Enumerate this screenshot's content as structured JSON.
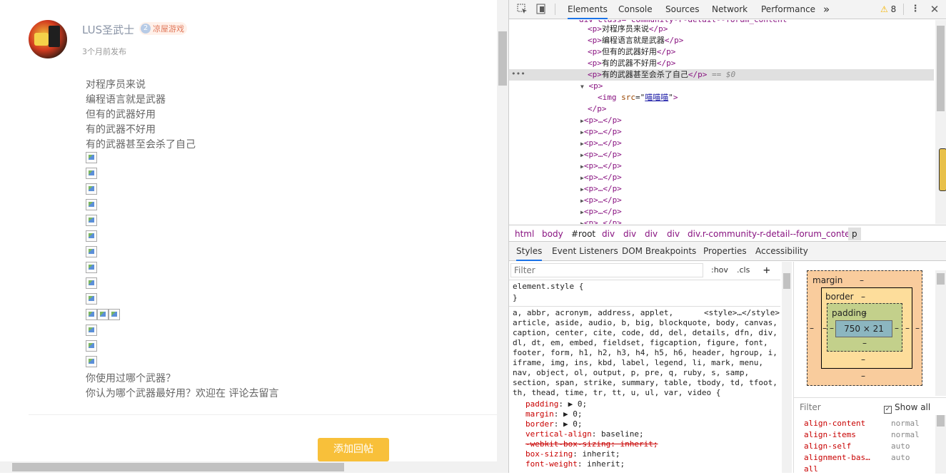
{
  "post": {
    "username": "LUS圣武士",
    "level_badge": "2",
    "level_name": "凉屋游戏",
    "post_time": "3个月前发布",
    "content_lines": [
      "对程序员来说",
      "编程语言就是武器",
      "但有的武器好用",
      "有的武器不好用",
      "有的武器甚至会杀了自己"
    ],
    "outro_lines": [
      "你使用过哪个武器？",
      "你认为哪个武器最好用？欢迎在 评论去留言"
    ],
    "reply_button": "添加回帖"
  },
  "devtools": {
    "tabs": [
      "Elements",
      "Console",
      "Sources",
      "Network",
      "Performance"
    ],
    "more": "»",
    "warnings": "8",
    "dom": {
      "header_cut": "div class=\"community-r-detail--forum_content\"",
      "p_lines": [
        "对程序员来说",
        "编程语言就是武器",
        "但有的武器好用",
        "有的武器不好用",
        "有的武器甚至会杀了自己"
      ],
      "selected_suffix": "== $0",
      "img_tag": "img",
      "img_attr": "src",
      "img_src": "喵喵喵",
      "collapsed": "<p>…</p>"
    },
    "breadcrumbs": [
      "html",
      "body",
      "#root",
      "div",
      "div",
      "div",
      "div",
      "div.r-community-r-detail--forum_content",
      "p"
    ],
    "sub_tabs": [
      "Styles",
      "Event Listeners",
      "DOM Breakpoints",
      "Properties",
      "Accessibility"
    ],
    "styles": {
      "filter_placeholder": "Filter",
      "hov": ":hov",
      "cls": ".cls",
      "plus": "+",
      "element_style": "element.style {",
      "close_brace": "}",
      "ua_source": "<style>…</style>",
      "selector_lines": [
        "a, abbr, acronym, address, applet,",
        "article, aside, audio, b, big, blockquote, body, canvas,",
        "caption, center, cite, code, dd, del, details, dfn, div,",
        "dl, dt, em, embed, fieldset, figcaption, figure, font,",
        "footer, form, h1, h2, h3, h4, h5, h6, header, hgroup, i,",
        "iframe, img, ins, kbd, label, legend, li, mark, menu,",
        "nav, object, ol, output, p, pre, q, ruby, s, samp,",
        "section, span, strike, summary, table, tbody, td, tfoot,",
        "th, thead, time, tr, tt, u, ul, var, video {"
      ],
      "props": [
        {
          "name": "padding",
          "value": "0;",
          "arrow": true,
          "strike": false
        },
        {
          "name": "margin",
          "value": "0;",
          "arrow": true,
          "strike": false
        },
        {
          "name": "border",
          "value": "0;",
          "arrow": true,
          "strike": false
        },
        {
          "name": "vertical-align",
          "value": "baseline;",
          "arrow": false,
          "strike": false
        },
        {
          "name": "-webkit-box-sizing",
          "value": "inherit;",
          "arrow": false,
          "strike": true
        },
        {
          "name": "box-sizing",
          "value": "inherit;",
          "arrow": false,
          "strike": false
        },
        {
          "name": "font-weight",
          "value": "inherit;",
          "arrow": false,
          "strike": false
        }
      ]
    },
    "box_model": {
      "margin_label": "margin",
      "border_label": "border",
      "padding_label": "padding",
      "dash": "–",
      "content_size": "750 × 21"
    },
    "computed": {
      "filter": "Filter",
      "show_all": "Show all",
      "rows": [
        {
          "k": "align-content",
          "v": "normal"
        },
        {
          "k": "align-items",
          "v": "normal"
        },
        {
          "k": "align-self",
          "v": "auto"
        },
        {
          "k": "alignment-bas…",
          "v": "auto"
        },
        {
          "k": "all",
          "v": ""
        }
      ]
    }
  }
}
